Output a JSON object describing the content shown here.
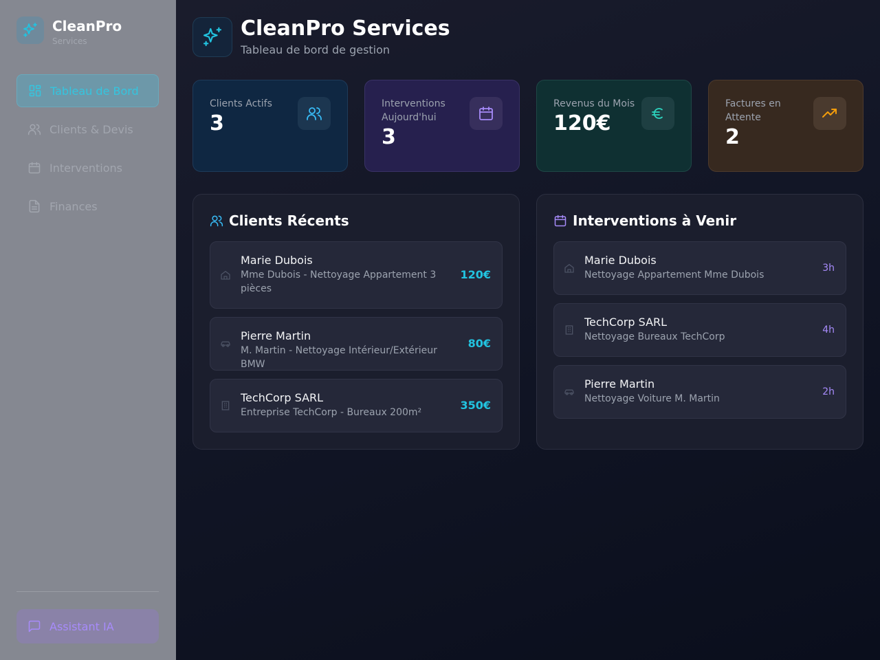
{
  "sidebar": {
    "brand_name": "CleanPro",
    "brand_sub": "Services",
    "nav": [
      {
        "label": "Tableau de Bord",
        "icon": "dashboard-icon",
        "active": true
      },
      {
        "label": "Clients & Devis",
        "icon": "users-icon",
        "active": false
      },
      {
        "label": "Interventions",
        "icon": "calendar-icon",
        "active": false
      },
      {
        "label": "Finances",
        "icon": "file-icon",
        "active": false
      }
    ],
    "assistant_label": "Assistant IA"
  },
  "header": {
    "title": "CleanPro Services",
    "subtitle": "Tableau de bord de gestion"
  },
  "stats": [
    {
      "label": "Clients Actifs",
      "value": "3",
      "icon": "users-icon",
      "color": "#38bdf8"
    },
    {
      "label": "Interventions Aujourd'hui",
      "value": "3",
      "icon": "calendar-icon",
      "color": "#a78bfa"
    },
    {
      "label": "Revenus du Mois",
      "value": "120€",
      "icon": "euro-icon",
      "color": "#2dd4bf"
    },
    {
      "label": "Factures en Attente",
      "value": "2",
      "icon": "trending-up-icon",
      "color": "#f59e0b"
    }
  ],
  "recent_clients": {
    "title": "Clients Récents",
    "items": [
      {
        "name": "Marie Dubois",
        "desc": "Mme Dubois - Nettoyage Appartement 3 pièces",
        "amount": "120€",
        "icon": "home-icon"
      },
      {
        "name": "Pierre Martin",
        "desc": "M. Martin - Nettoyage Intérieur/Extérieur BMW",
        "amount": "80€",
        "icon": "car-icon"
      },
      {
        "name": "TechCorp SARL",
        "desc": "Entreprise TechCorp - Bureaux 200m²",
        "amount": "350€",
        "icon": "building-icon"
      }
    ]
  },
  "upcoming": {
    "title": "Interventions à Venir",
    "items": [
      {
        "name": "Marie Dubois",
        "desc": "Nettoyage Appartement Mme Dubois",
        "duration": "3h",
        "icon": "home-icon"
      },
      {
        "name": "TechCorp SARL",
        "desc": "Nettoyage Bureaux TechCorp",
        "duration": "4h",
        "icon": "building-icon"
      },
      {
        "name": "Pierre Martin",
        "desc": "Nettoyage Voiture M. Martin",
        "duration": "2h",
        "icon": "car-icon"
      }
    ]
  },
  "colors": {
    "accent": "#22c3e0",
    "purple": "#a78bfa",
    "amber": "#f59e0b"
  }
}
